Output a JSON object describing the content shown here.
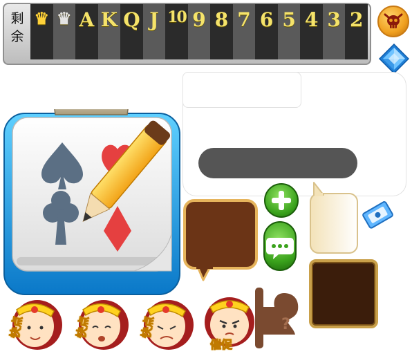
{
  "counter": {
    "label_line1": "剩",
    "label_line2": "余",
    "cells": [
      {
        "text": "♛",
        "kind": "big-joker-crown"
      },
      {
        "text": "♛",
        "kind": "small-joker-crown"
      },
      {
        "text": "A"
      },
      {
        "text": "K"
      },
      {
        "text": "Q"
      },
      {
        "text": "J"
      },
      {
        "text": "10"
      },
      {
        "text": "9"
      },
      {
        "text": "8"
      },
      {
        "text": "7"
      },
      {
        "text": "6"
      },
      {
        "text": "5"
      },
      {
        "text": "4"
      },
      {
        "text": "3"
      },
      {
        "text": "2"
      }
    ]
  },
  "faces": [
    {
      "caption": "快点"
    },
    {
      "caption": "快点"
    },
    {
      "caption": "快点"
    },
    {
      "caption": "催促"
    }
  ],
  "colors": {
    "counter_text": "#f5e36a",
    "dark_pill": "#555555",
    "green_button": "#3aa21c",
    "brown_bubble": "#6b3416",
    "gold_frame": "#c9a04a"
  },
  "icons": {
    "skull_button": "skull-icon",
    "diamond_button": "diamond-icon",
    "record_icon": "card-record-icon",
    "plus": "plus-icon",
    "chat": "chat-icon",
    "ticket": "ticket-icon",
    "stamp": "stamp-icon"
  }
}
